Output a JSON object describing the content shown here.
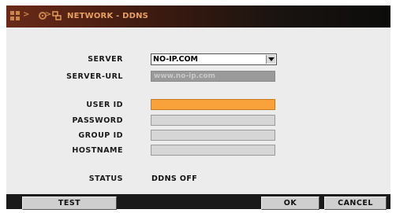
{
  "window": {
    "title": "NETWORK - DDNS"
  },
  "breadcrumb": {
    "separator": ">",
    "icons": [
      "grid-icon",
      "gear-icon",
      "network-icon"
    ]
  },
  "form": {
    "server_label": "SERVER",
    "server_value": "NO-IP.COM",
    "server_url_label": "SERVER-URL",
    "server_url_value": "www.no-ip.com",
    "user_id_label": "USER ID",
    "user_id_value": "",
    "password_label": "PASSWORD",
    "password_value": "",
    "group_id_label": "GROUP ID",
    "group_id_value": "",
    "hostname_label": "HOSTNAME",
    "hostname_value": "",
    "status_label": "STATUS",
    "status_value": "DDNS OFF"
  },
  "buttons": {
    "test": "TEST",
    "ok": "OK",
    "cancel": "CANCEL"
  },
  "colors": {
    "accent": "#f9a23c",
    "title_text": "#e8a060",
    "panel": "#ececec",
    "footer": "#1a1a1a"
  }
}
